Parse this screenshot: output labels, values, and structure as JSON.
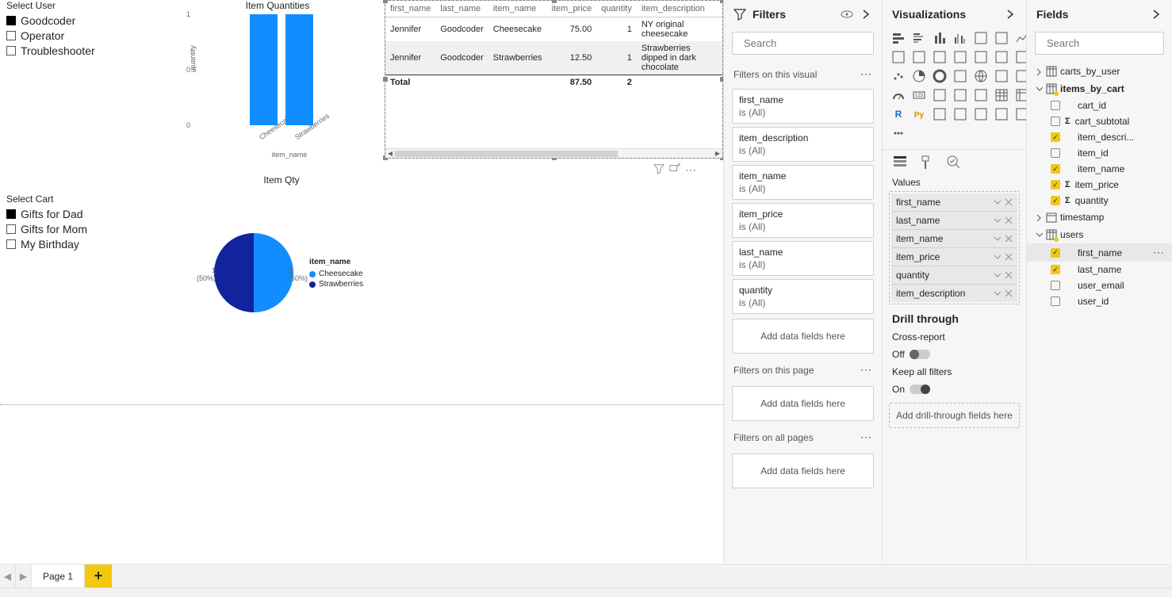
{
  "slicer_user": {
    "title": "Select User",
    "items": [
      {
        "label": "Goodcoder",
        "checked": true
      },
      {
        "label": "Operator",
        "checked": false
      },
      {
        "label": "Troubleshooter",
        "checked": false
      }
    ]
  },
  "slicer_cart": {
    "title": "Select Cart",
    "items": [
      {
        "label": "Gifts for Dad",
        "checked": true
      },
      {
        "label": "Gifts for Mom",
        "checked": false
      },
      {
        "label": "My Birthday",
        "checked": false
      }
    ]
  },
  "chart_data": [
    {
      "type": "bar",
      "title": "Item Quantities",
      "xlabel": "item_name",
      "ylabel": "quantity",
      "ylim": [
        0,
        1
      ],
      "yticks": [
        0.0,
        0.5,
        1.0
      ],
      "categories": [
        "Cheesecake",
        "Strawberries"
      ],
      "values": [
        1,
        1
      ]
    },
    {
      "type": "pie",
      "title": "Item Qty",
      "legend_title": "item_name",
      "categories": [
        "Cheesecake",
        "Strawberries"
      ],
      "values": [
        1,
        1
      ],
      "percentages": [
        "(50%)",
        "(50%)"
      ],
      "colors": [
        "#118DFF",
        "#12239E"
      ]
    }
  ],
  "table": {
    "columns": [
      "first_name",
      "last_name",
      "item_name",
      "item_price",
      "quantity",
      "item_description"
    ],
    "rows": [
      [
        "Jennifer",
        "Goodcoder",
        "Cheesecake",
        "75.00",
        "1",
        "NY original cheesecake"
      ],
      [
        "Jennifer",
        "Goodcoder",
        "Strawberries",
        "12.50",
        "1",
        "Strawberries dipped in dark chocolate"
      ]
    ],
    "total_label": "Total",
    "total_price": "87.50",
    "total_qty": "2"
  },
  "filters": {
    "pane_title": "Filters",
    "search_placeholder": "Search",
    "sections": {
      "visual": "Filters on this visual",
      "page": "Filters on this page",
      "all": "Filters on all pages"
    },
    "cards": [
      {
        "name": "first_name",
        "value": "is (All)"
      },
      {
        "name": "item_description",
        "value": "is (All)"
      },
      {
        "name": "item_name",
        "value": "is (All)"
      },
      {
        "name": "item_price",
        "value": "is (All)"
      },
      {
        "name": "last_name",
        "value": "is (All)"
      },
      {
        "name": "quantity",
        "value": "is (All)"
      }
    ],
    "drop_text": "Add data fields here"
  },
  "viz": {
    "pane_title": "Visualizations",
    "values_title": "Values",
    "values": [
      "first_name",
      "last_name",
      "item_name",
      "item_price",
      "quantity",
      "item_description"
    ],
    "drill_title": "Drill through",
    "cross_report": "Cross-report",
    "cross_state": "Off",
    "keep_filters": "Keep all filters",
    "keep_state": "On",
    "drill_drop": "Add drill-through fields here"
  },
  "fields": {
    "pane_title": "Fields",
    "search_placeholder": "Search",
    "tables": [
      {
        "name": "carts_by_user",
        "expanded": false,
        "bold": false,
        "yellow": false
      },
      {
        "name": "items_by_cart",
        "expanded": true,
        "bold": true,
        "yellow": true,
        "fields": [
          {
            "name": "cart_id",
            "checked": false,
            "sigma": false
          },
          {
            "name": "cart_subtotal",
            "checked": false,
            "sigma": true
          },
          {
            "name": "item_descri...",
            "checked": true,
            "sigma": false
          },
          {
            "name": "item_id",
            "checked": false,
            "sigma": false
          },
          {
            "name": "item_name",
            "checked": true,
            "sigma": false
          },
          {
            "name": "item_price",
            "checked": true,
            "sigma": true
          },
          {
            "name": "quantity",
            "checked": true,
            "sigma": true
          }
        ]
      },
      {
        "name": "timestamp",
        "expanded": false,
        "bold": false,
        "yellow": false,
        "date": true
      },
      {
        "name": "users",
        "expanded": true,
        "bold": false,
        "yellow": true,
        "fields": [
          {
            "name": "first_name",
            "checked": true,
            "sigma": false,
            "hover": true
          },
          {
            "name": "last_name",
            "checked": true,
            "sigma": false
          },
          {
            "name": "user_email",
            "checked": false,
            "sigma": false
          },
          {
            "name": "user_id",
            "checked": false,
            "sigma": false
          }
        ]
      }
    ]
  },
  "page_tab": "Page 1"
}
